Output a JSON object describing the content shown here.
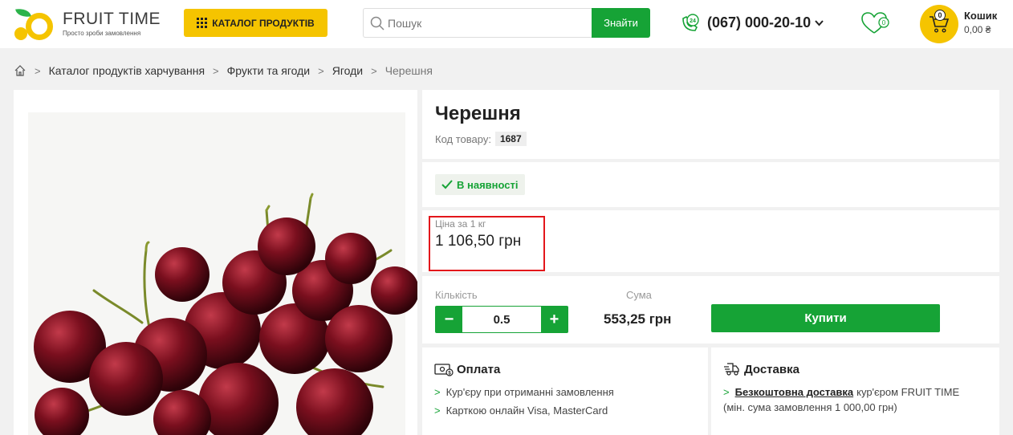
{
  "header": {
    "logo_title": "FRUIT TIME",
    "logo_subtitle": "Просто зроби замовлення",
    "catalog_label": "КАТАЛОГ ПРОДУКТІВ",
    "search_placeholder": "Пошук",
    "search_button": "Знайти",
    "phone": "(067) 000-20-10",
    "phone_badge": "24",
    "wishlist_count": "0",
    "cart_count": "0",
    "cart_label": "Кошик",
    "cart_sum": "0,00 ₴"
  },
  "breadcrumb": [
    "Каталог продуктів харчування",
    "Фрукти та ягоди",
    "Ягоди",
    "Черешня"
  ],
  "product": {
    "title": "Черешня",
    "code_label": "Код товару:",
    "code": "1687",
    "stock": "В наявності",
    "price_label": "Ціна за 1 кг",
    "price": "1 106,50 грн",
    "qty_label": "Кількість",
    "qty": "0.5",
    "sum_label": "Сума",
    "sum": "553,25 грн",
    "buy": "Купити",
    "minus": "−",
    "plus": "+"
  },
  "payment": {
    "title": "Оплата",
    "items": [
      "Кур'єру при отриманні замовлення",
      "Карткою онлайн Visa, MasterCard"
    ]
  },
  "delivery": {
    "title": "Доставка",
    "link": "Безкоштовна доставка",
    "text": "кур'єром FRUIT TIME",
    "note": "(мін. сума замовлення 1 000,00 грн)"
  },
  "colors": {
    "accent_yellow": "#f5c400",
    "accent_green": "#16a336",
    "highlight_red": "#e3161b"
  }
}
